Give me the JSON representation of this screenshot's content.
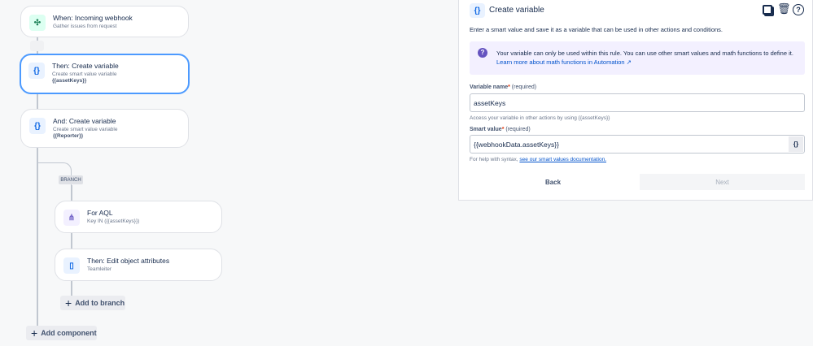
{
  "flow": {
    "trigger": {
      "title": "When: Incoming webhook",
      "subtitle": "Gather issues from request"
    },
    "action1": {
      "title": "Then: Create variable",
      "subtitle": "Create smart value variable",
      "value": "{{assetKeys}}"
    },
    "action2": {
      "title": "And: Create variable",
      "subtitle": "Create smart value variable",
      "value": "{{Reporter}}"
    },
    "branch_label": "BRANCH",
    "branch_item1": {
      "title": "For AQL",
      "subtitle": "Key IN ({{assetKeys}})"
    },
    "branch_item2": {
      "title": "Then: Edit object attributes",
      "subtitle": "Teamleiter"
    },
    "add_to_branch": "Add to branch",
    "add_component": "Add component"
  },
  "panel": {
    "title": "Create variable",
    "description": "Enter a smart value and save it as a variable that can be used in other actions and conditions.",
    "info_text": "Your variable can only be used within this rule. You can use other smart values and math functions to define it.",
    "info_link": "Learn more about math functions in Automation ↗",
    "var_name_label": "Variable name",
    "required": "(required)",
    "var_name_value": "assetKeys",
    "var_name_help": "Access your variable in other actions by using {{assetKeys}}",
    "smart_value_label": "Smart value",
    "smart_value_value": "{{webhookData.assetKeys}}",
    "smart_help_prefix": "For help with syntax,",
    "smart_help_link": "see our smart values documentation.",
    "back": "Back",
    "next": "Next",
    "icons": [
      "copy-icon",
      "trash-icon",
      "help-icon"
    ],
    "curly": "{}",
    "star": "*"
  },
  "colors": {
    "accent": "#4c9aff",
    "info_bg": "#f3f0ff",
    "info_icon": "#6554c0"
  }
}
